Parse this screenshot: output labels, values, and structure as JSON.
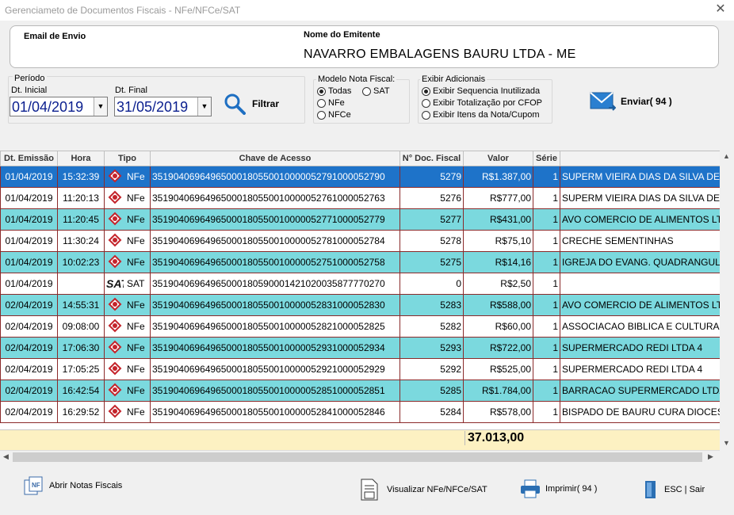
{
  "window": {
    "title": "Gerenciameto de Documentos Fiscais - NFe/NFCe/SAT",
    "close": "✕"
  },
  "header": {
    "email_label": "Email de Envio",
    "email_value": "",
    "emitente_label": "Nome do Emitente",
    "emitente_value": "NAVARRO EMBALAGENS BAURU LTDA - ME"
  },
  "periodo": {
    "legend": "Período",
    "inicial_label": "Dt. Inicial",
    "inicial_value": "01/04/2019",
    "final_label": "Dt. Final",
    "final_value": "31/05/2019",
    "dropdown": "▼"
  },
  "filtrar": {
    "label": "Filtrar"
  },
  "modelo": {
    "legend": "Modelo Nota Fiscal:",
    "options": [
      "Todas",
      "SAT",
      "NFe",
      "NFCe"
    ],
    "selected": "Todas"
  },
  "exibir": {
    "legend": "Exibir Adicionais",
    "options": [
      "Exibir Sequencia Inutilizada",
      "Exibir Totalização por CFOP",
      "Exibir Itens da Nota/Cupom"
    ],
    "selected": "Exibir Sequencia Inutilizada"
  },
  "enviar": {
    "label": "Enviar( 94 )"
  },
  "table": {
    "headers": [
      "Dt. Emissão",
      "Hora",
      "Tipo",
      "Chave de Acesso",
      "N° Doc. Fiscal",
      "Valor",
      "Série",
      ""
    ],
    "rows": [
      [
        "01/04/2019",
        "15:32:39",
        "NFe",
        "35190406964965000180550010000052791000052790",
        "5279",
        "R$1.387,00",
        "1",
        "SUPERM VIEIRA DIAS DA SILVA DE"
      ],
      [
        "01/04/2019",
        "11:20:13",
        "NFe",
        "35190406964965000180550010000052761000052763",
        "5276",
        "R$777,00",
        "1",
        "SUPERM VIEIRA DIAS DA SILVA DE"
      ],
      [
        "01/04/2019",
        "11:20:45",
        "NFe",
        "35190406964965000180550010000052771000052779",
        "5277",
        "R$431,00",
        "1",
        "AVO COMERCIO DE ALIMENTOS LT"
      ],
      [
        "01/04/2019",
        "11:30:24",
        "NFe",
        "35190406964965000180550010000052781000052784",
        "5278",
        "R$75,10",
        "1",
        "CRECHE SEMENTINHAS"
      ],
      [
        "01/04/2019",
        "10:02:23",
        "NFe",
        "35190406964965000180550010000052751000052758",
        "5275",
        "R$14,16",
        "1",
        "IGREJA DO EVANG. QUADRANGULA"
      ],
      [
        "01/04/2019",
        "",
        "SAT",
        "35190406964965000180590001421020035877770270",
        "0",
        "R$2,50",
        "1",
        ""
      ],
      [
        "02/04/2019",
        "14:55:31",
        "NFe",
        "35190406964965000180550010000052831000052830",
        "5283",
        "R$588,00",
        "1",
        "AVO COMERCIO DE ALIMENTOS LT"
      ],
      [
        "02/04/2019",
        "09:08:00",
        "NFe",
        "35190406964965000180550010000052821000052825",
        "5282",
        "R$60,00",
        "1",
        "ASSOCIACAO BIBLICA E CULTURAL"
      ],
      [
        "02/04/2019",
        "17:06:30",
        "NFe",
        "35190406964965000180550010000052931000052934",
        "5293",
        "R$722,00",
        "1",
        "SUPERMERCADO REDI LTDA 4"
      ],
      [
        "02/04/2019",
        "17:05:25",
        "NFe",
        "35190406964965000180550010000052921000052929",
        "5292",
        "R$525,00",
        "1",
        "SUPERMERCADO REDI LTDA 4"
      ],
      [
        "02/04/2019",
        "16:42:54",
        "NFe",
        "35190406964965000180550010000052851000052851",
        "5285",
        "R$1.784,00",
        "1",
        "BARRACAO SUPERMERCADO LTDA"
      ],
      [
        "02/04/2019",
        "16:29:52",
        "NFe",
        "35190406964965000180550010000052841000052846",
        "5284",
        "R$578,00",
        "1",
        "BISPADO DE BAURU CURA DIOCES."
      ]
    ],
    "row_styles": [
      "sel",
      "white",
      "teal",
      "white",
      "teal",
      "white",
      "teal",
      "white",
      "teal",
      "white",
      "teal",
      "white"
    ]
  },
  "summary": {
    "total": "37.013,00"
  },
  "footer": {
    "abrir": "Abrir Notas Fiscais",
    "visualizar": "Visualizar NFe/NFCe/SAT",
    "imprimir": "Imprimir( 94 )",
    "sair": "ESC | Sair"
  },
  "colors": {
    "teal_row": "#7bd9de",
    "selected_row": "#1e73c9",
    "summary_bg": "#fdf1c2",
    "date_text": "#0b1f8f"
  }
}
